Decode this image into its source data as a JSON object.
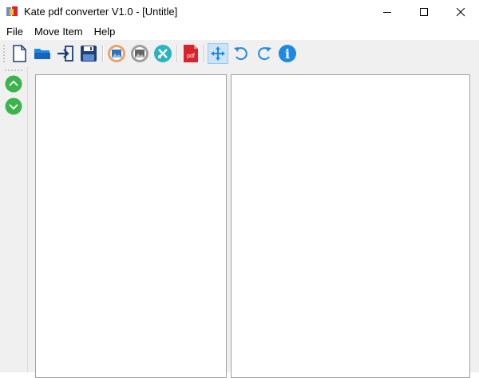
{
  "window": {
    "title": "Kate pdf converter V1.0 - [Untitle]"
  },
  "menu": {
    "items": [
      "File",
      "Move Item",
      "Help"
    ]
  },
  "toolbar": {
    "buttons": [
      {
        "name": "new-file-icon"
      },
      {
        "name": "open-folder-icon"
      },
      {
        "name": "import-icon"
      },
      {
        "name": "save-icon"
      },
      {
        "name": "add-image-icon"
      },
      {
        "name": "image-icon"
      },
      {
        "name": "tools-icon"
      },
      {
        "name": "pdf-icon",
        "label": "pdf"
      },
      {
        "name": "fit-icon"
      },
      {
        "name": "rotate-left-icon"
      },
      {
        "name": "rotate-right-icon"
      },
      {
        "name": "info-icon",
        "label": "i"
      }
    ]
  },
  "sidebar": {
    "buttons": [
      {
        "name": "move-up-icon"
      },
      {
        "name": "move-down-icon"
      }
    ]
  },
  "colors": {
    "toolbar_bg": "#f0f0f0",
    "active_button": "#cce4f7",
    "green": "#3cb44b",
    "blue": "#1e88e5",
    "pdf_red": "#d9232d"
  }
}
